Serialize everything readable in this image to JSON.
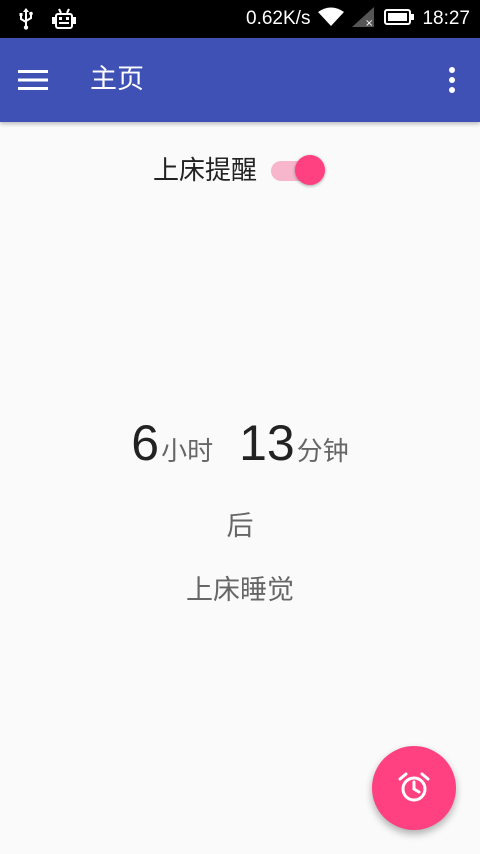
{
  "status_bar": {
    "network_speed": "0.62K/s",
    "time": "18:27",
    "icons": [
      "usb-icon",
      "android-debug-icon",
      "wifi-icon",
      "signal-icon",
      "battery-icon"
    ]
  },
  "app_bar": {
    "title": "主页",
    "menu_icon": "hamburger-menu-icon",
    "overflow_icon": "more-vert-icon",
    "color": "#3f51b5"
  },
  "reminder": {
    "label": "上床提醒",
    "enabled": true,
    "accent_color": "#ff4081"
  },
  "countdown": {
    "hours": "6",
    "hours_unit": "小时",
    "minutes": "13",
    "minutes_unit": "分钟",
    "after": "后",
    "action": "上床睡觉"
  },
  "fab": {
    "icon": "alarm-clock-icon",
    "color": "#ff4081"
  }
}
